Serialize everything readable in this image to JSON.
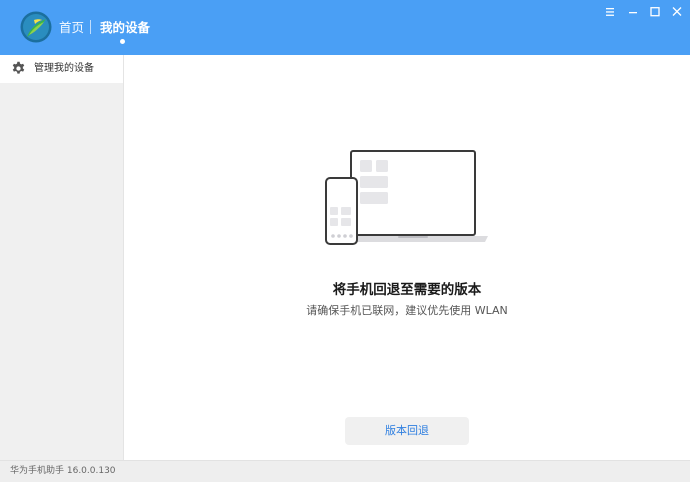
{
  "header": {
    "nav": {
      "home_label": "首页",
      "devices_label": "我的设备"
    },
    "colors": {
      "titlebar_bg": "#4a9ff5"
    }
  },
  "sidebar": {
    "items": [
      {
        "label": "管理我的设备",
        "icon": "gear-icon",
        "selected": true
      }
    ]
  },
  "main": {
    "title": "将手机回退至需要的版本",
    "subtitle": "请确保手机已联网，建议优先使用 WLAN",
    "rollback_button_label": "版本回退",
    "illustration": "phone-and-laptop-illustration"
  },
  "status_bar": {
    "text": "华为手机助手 16.0.0.130"
  },
  "window_controls": [
    "menu-icon",
    "minimize-icon",
    "maximize-icon",
    "close-icon"
  ]
}
